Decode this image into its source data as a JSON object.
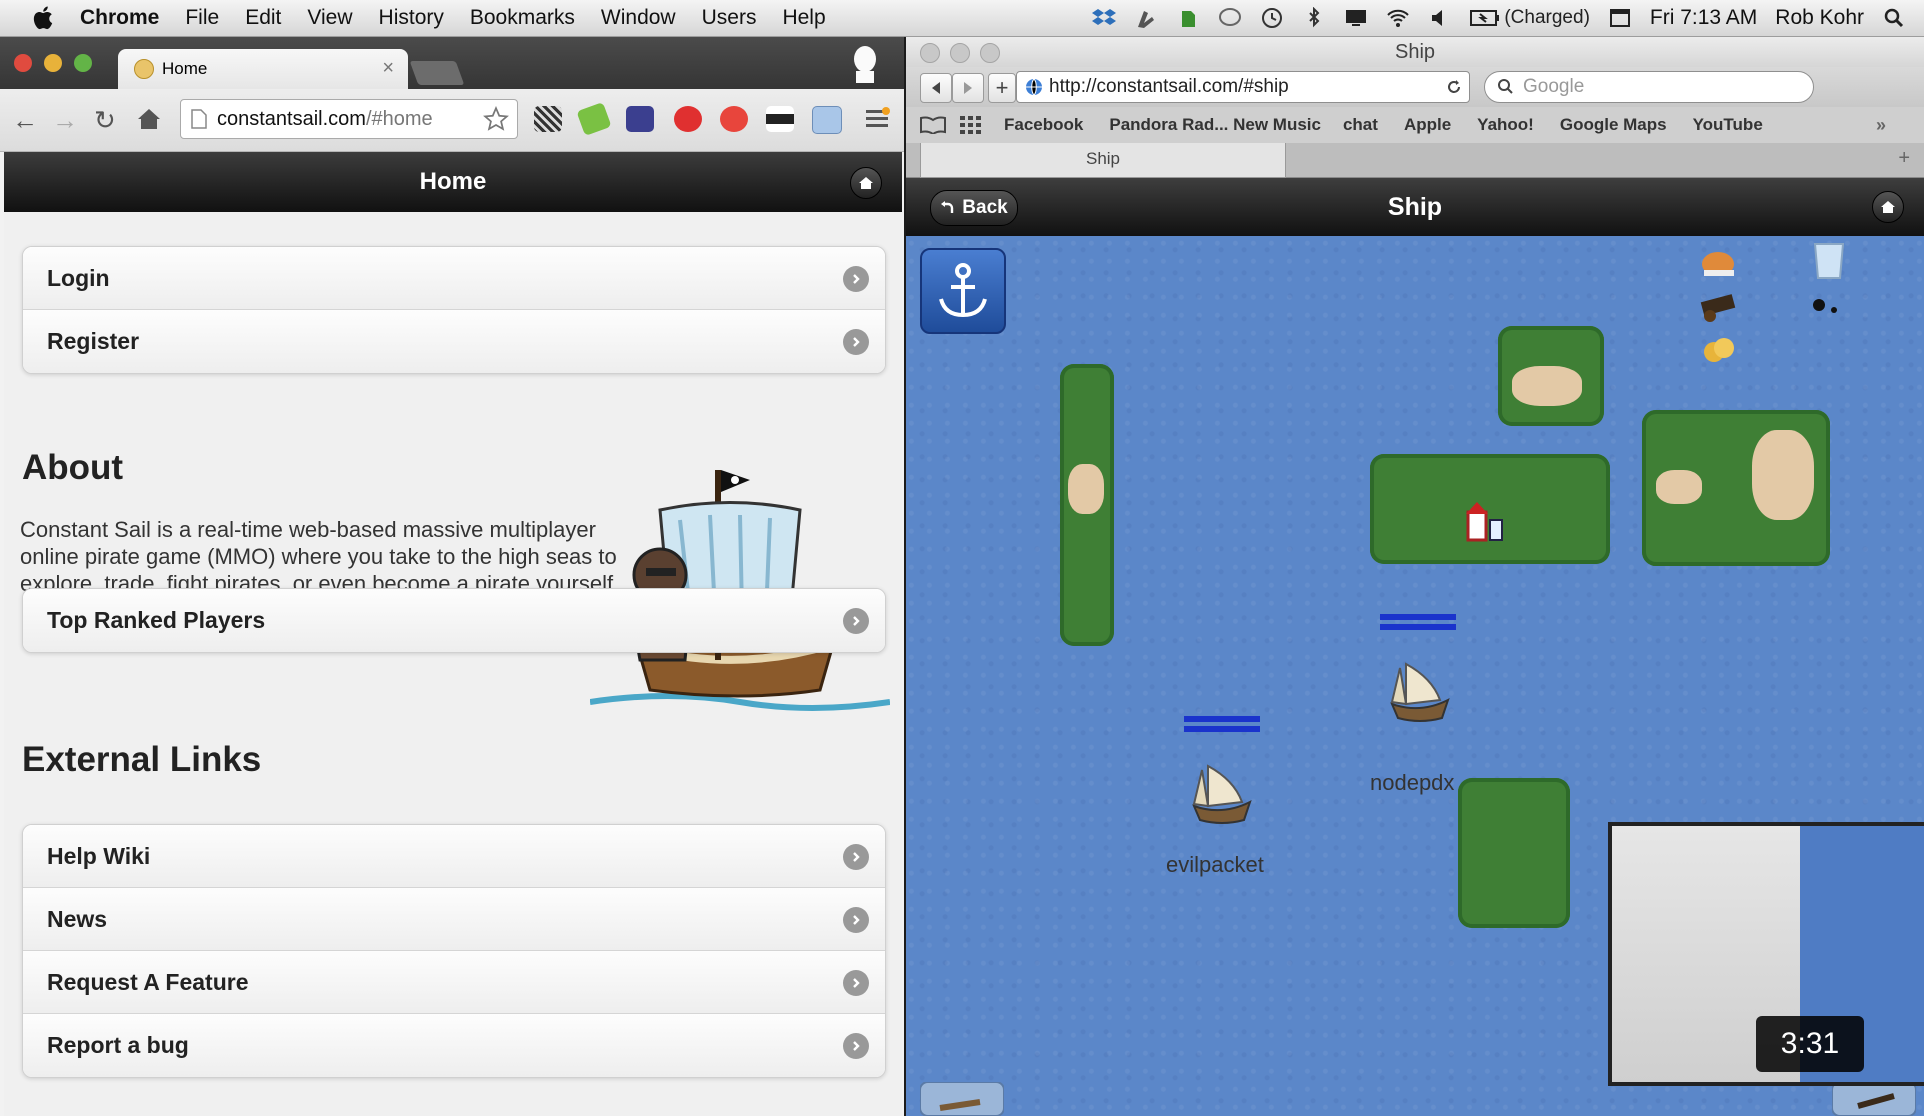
{
  "menubar": {
    "app_name": "Chrome",
    "menus": [
      "File",
      "Edit",
      "View",
      "History",
      "Bookmarks",
      "Window",
      "Users",
      "Help"
    ],
    "battery": "(Charged)",
    "clock": "Fri 7:13 AM",
    "user": "Rob Kohr"
  },
  "chrome": {
    "tab_title": "Home",
    "tab_close": "×",
    "url_host": "constantsail.com",
    "url_path": "/#home"
  },
  "home_page": {
    "header_title": "Home",
    "top_items": [
      "Login",
      "Register"
    ],
    "about_heading": "About",
    "about_text": "Constant Sail is a real-time web-based massive multiplayer online pirate game (MMO) where you take to the high seas to explore, trade, fight pirates, or even become a pirate yourself.",
    "ranked_item": "Top Ranked Players",
    "external_heading": "External Links",
    "external_items": [
      "Help Wiki",
      "News",
      "Request A Feature",
      "Report a bug"
    ]
  },
  "safari": {
    "window_title": "Ship",
    "url": "http://constantsail.com/#ship",
    "search_placeholder": "Google",
    "bookmarks": [
      "Facebook",
      "Pandora Rad... New Music",
      "chat",
      "Apple",
      "Yahoo!",
      "Google Maps",
      "YouTube"
    ],
    "tab_title": "Ship"
  },
  "ship_page": {
    "header_title": "Ship",
    "back_label": "Back",
    "players": [
      "nodepdx",
      "evilpacket"
    ]
  },
  "video": {
    "timestamp": "3:31"
  }
}
